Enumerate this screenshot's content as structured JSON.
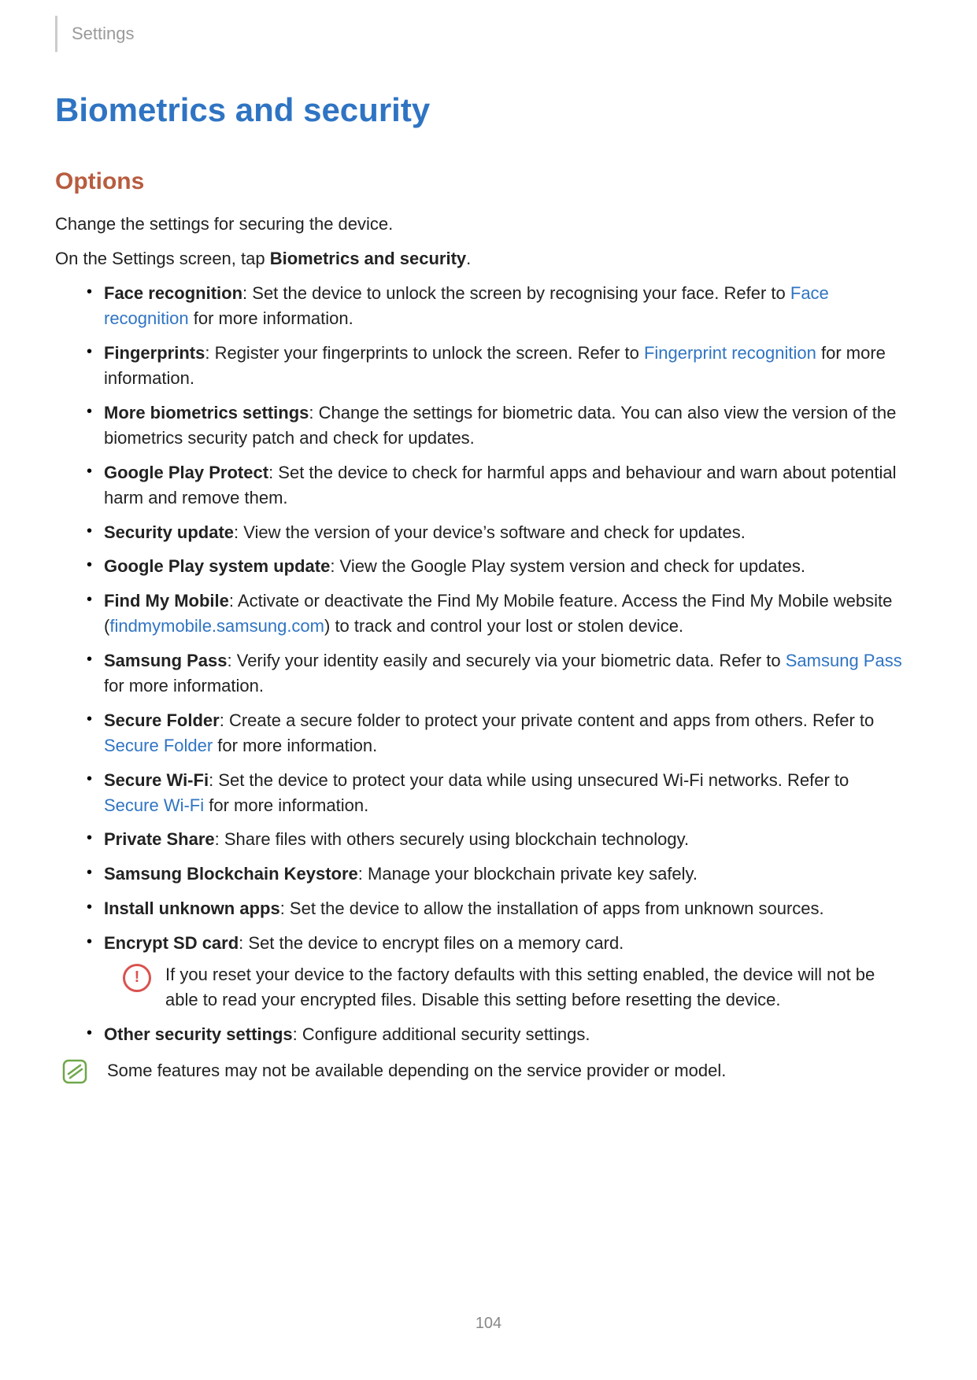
{
  "breadcrumb": "Settings",
  "title": "Biometrics and security",
  "subtitle": "Options",
  "intro1": "Change the settings for securing the device.",
  "intro2_a": "On the Settings screen, tap ",
  "intro2_b": "Biometrics and security",
  "intro2_c": ".",
  "items": [
    {
      "label": "Face recognition",
      "text1": ": Set the device to unlock the screen by recognising your face. Refer to ",
      "link1": "Face recognition",
      "text2": " for more information."
    },
    {
      "label": "Fingerprints",
      "text1": ": Register your fingerprints to unlock the screen. Refer to ",
      "link1": "Fingerprint recognition",
      "text2": " for more information."
    },
    {
      "label": "More biometrics settings",
      "text1": ": Change the settings for biometric data. You can also view the version of the biometrics security patch and check for updates."
    },
    {
      "label": "Google Play Protect",
      "text1": ": Set the device to check for harmful apps and behaviour and warn about potential harm and remove them."
    },
    {
      "label": "Security update",
      "text1": ": View the version of your device’s software and check for updates."
    },
    {
      "label": "Google Play system update",
      "text1": ": View the Google Play system version and check for updates."
    },
    {
      "label": "Find My Mobile",
      "text1": ": Activate or deactivate the Find My Mobile feature. Access the Find My Mobile website (",
      "link1": "findmymobile.samsung.com",
      "text2": ") to track and control your lost or stolen device."
    },
    {
      "label": "Samsung Pass",
      "text1": ": Verify your identity easily and securely via your biometric data. Refer to ",
      "link1": "Samsung Pass",
      "text2": " for more information."
    },
    {
      "label": "Secure Folder",
      "text1": ": Create a secure folder to protect your private content and apps from others. Refer to ",
      "link1": "Secure Folder",
      "text2": " for more information."
    },
    {
      "label": "Secure Wi-Fi",
      "text1": ": Set the device to protect your data while using unsecured Wi-Fi networks. Refer to ",
      "link1": "Secure Wi-Fi",
      "text2": " for more information."
    },
    {
      "label": "Private Share",
      "text1": ": Share files with others securely using blockchain technology."
    },
    {
      "label": "Samsung Blockchain Keystore",
      "text1": ": Manage your blockchain private key safely."
    },
    {
      "label": "Install unknown apps",
      "text1": ": Set the device to allow the installation of apps from unknown sources."
    },
    {
      "label": "Encrypt SD card",
      "text1": ": Set the device to encrypt files on a memory card.",
      "warning": "If you reset your device to the factory defaults with this setting enabled, the device will not be able to read your encrypted files. Disable this setting before resetting the device."
    },
    {
      "label": "Other security settings",
      "text1": ": Configure additional security settings."
    }
  ],
  "note": "Some features may not be available depending on the service provider or model.",
  "warning_glyph": "!",
  "page_number": "104"
}
